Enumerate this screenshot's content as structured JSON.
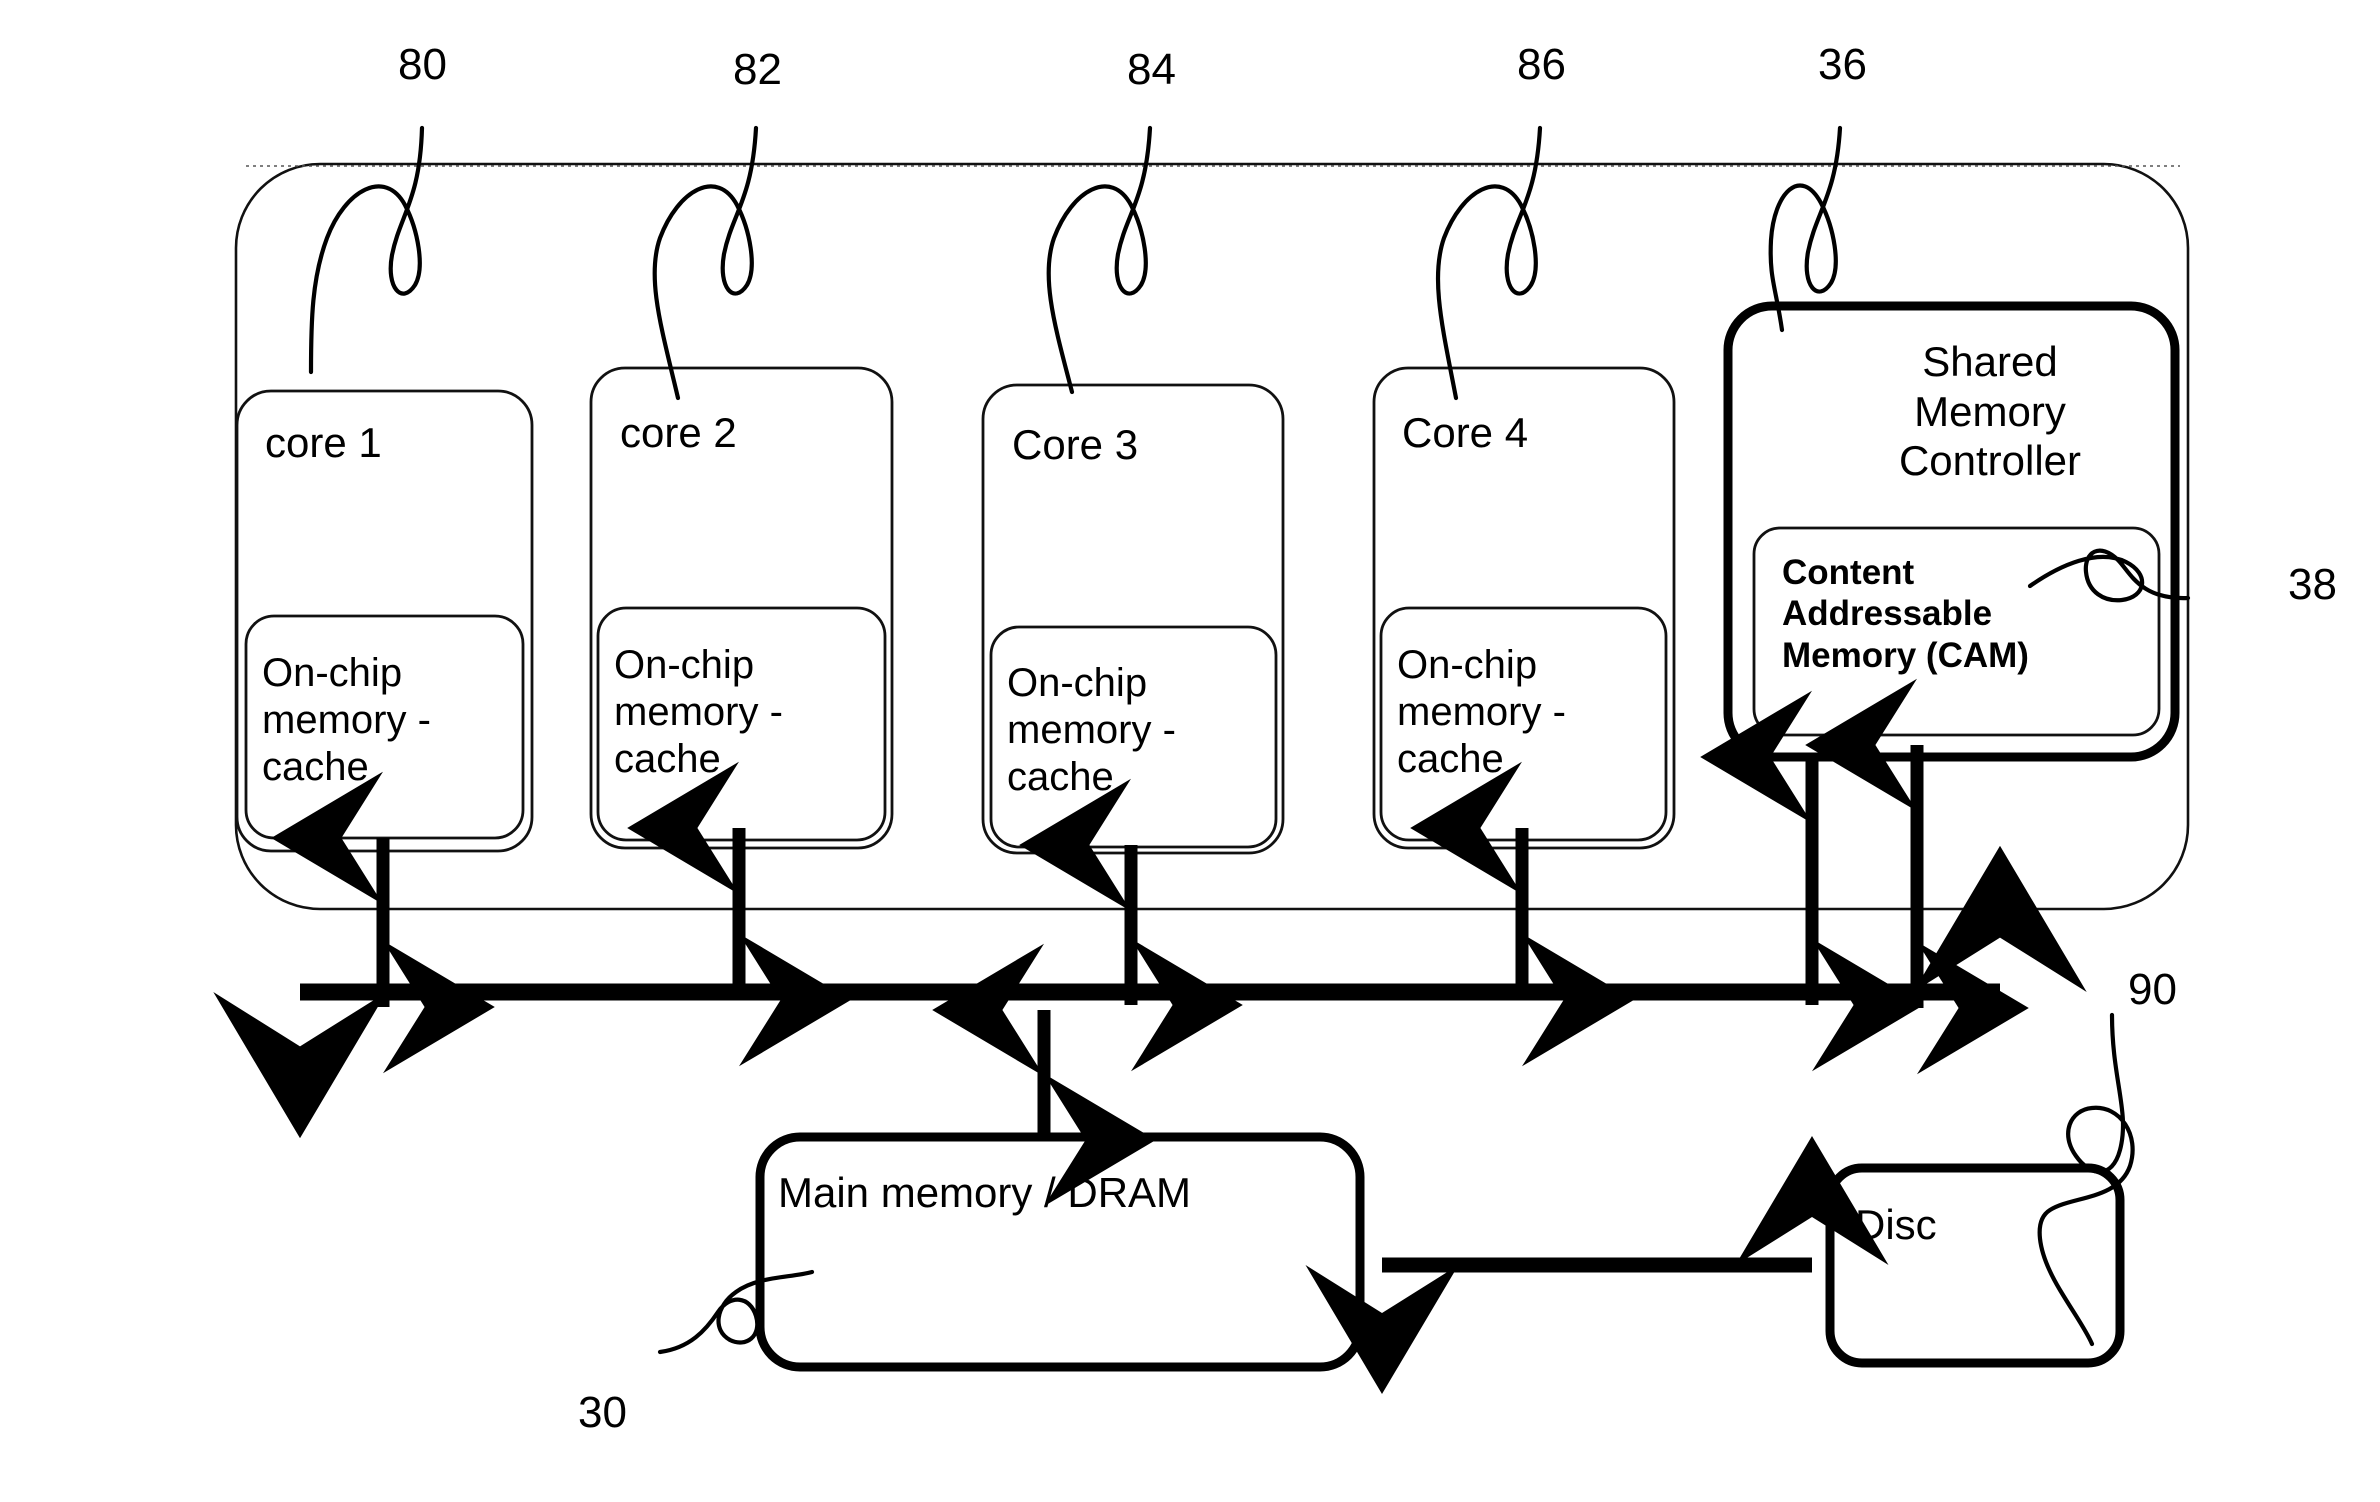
{
  "figure": {
    "type": "block-diagram",
    "subject": "Multicore processor with shared memory controller, CAM, bus, DRAM and disc"
  },
  "reference_numerals": [
    {
      "id": "ref-80",
      "text": "80",
      "points_to": "core-1-box"
    },
    {
      "id": "ref-82",
      "text": "82",
      "points_to": "core-2-box"
    },
    {
      "id": "ref-84",
      "text": "84",
      "points_to": "core-3-box"
    },
    {
      "id": "ref-86",
      "text": "86",
      "points_to": "core-4-box"
    },
    {
      "id": "ref-36",
      "text": "36",
      "points_to": "shared-memory-controller-box"
    },
    {
      "id": "ref-38",
      "text": "38",
      "points_to": "cam-box"
    },
    {
      "id": "ref-90",
      "text": "90",
      "points_to": "disc-box"
    },
    {
      "id": "ref-30",
      "text": "30",
      "points_to": "main-memory-box"
    }
  ],
  "cores": [
    {
      "title": "core 1",
      "cache": "On-chip\nmemory -\ncache"
    },
    {
      "title": "core 2",
      "cache": "On-chip\nmemory -\ncache"
    },
    {
      "title": "Core 3",
      "cache": "On-chip\nmemory -\ncache"
    },
    {
      "title": "Core 4",
      "cache": "On-chip\nmemory -\ncache"
    }
  ],
  "shared_memory_controller": {
    "title": "Shared\nMemory\nController",
    "cam_label": "Content\nAddressable\nMemory (CAM)"
  },
  "main_memory": {
    "label": "Main memory / DRAM"
  },
  "disc": {
    "label": "Disc"
  },
  "colors": {
    "stroke": "#000000",
    "background": "#ffffff",
    "thin": "#1a1a1a"
  }
}
